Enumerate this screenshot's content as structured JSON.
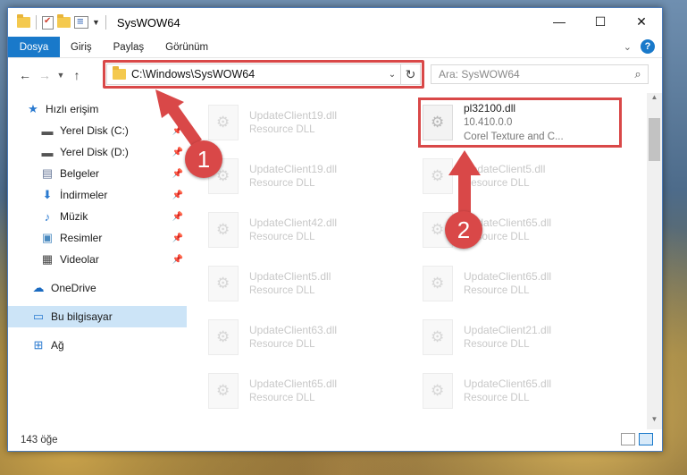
{
  "window": {
    "title": "SysWOW64"
  },
  "ribbon": {
    "tabs": [
      {
        "label": "Dosya"
      },
      {
        "label": "Giriş"
      },
      {
        "label": "Paylaş"
      },
      {
        "label": "Görünüm"
      }
    ],
    "help_label": "?"
  },
  "address": {
    "path": "C:\\Windows\\SysWOW64"
  },
  "search": {
    "placeholder": "Ara: SysWOW64"
  },
  "sidebar": {
    "items": [
      {
        "label": "Hızlı erişim",
        "icon": "star-icon"
      },
      {
        "label": "Yerel Disk (C:)",
        "icon": "drive-icon",
        "pinned": true
      },
      {
        "label": "Yerel Disk (D:)",
        "icon": "drive-icon",
        "pinned": true
      },
      {
        "label": "Belgeler",
        "icon": "documents-icon",
        "pinned": true
      },
      {
        "label": "İndirmeler",
        "icon": "download-icon",
        "pinned": true
      },
      {
        "label": "Müzik",
        "icon": "music-icon",
        "pinned": true
      },
      {
        "label": "Resimler",
        "icon": "pictures-icon",
        "pinned": true
      },
      {
        "label": "Videolar",
        "icon": "video-icon",
        "pinned": true
      },
      {
        "label": "OneDrive",
        "icon": "cloud-icon"
      },
      {
        "label": "Bu bilgisayar",
        "icon": "computer-icon",
        "selected": true
      },
      {
        "label": "Ağ",
        "icon": "network-icon"
      }
    ]
  },
  "files": {
    "highlighted": {
      "name": "pl32100.dll",
      "version": "10.410.0.0",
      "description": "Corel Texture and C..."
    },
    "left_column": [
      {
        "name": "UpdateClient19.dll",
        "type": "Resource DLL"
      },
      {
        "name": "UpdateClient19.dll",
        "type": "Resource DLL"
      },
      {
        "name": "UpdateClient42.dll",
        "type": "Resource DLL"
      },
      {
        "name": "UpdateClient5.dll",
        "type": "Resource DLL"
      },
      {
        "name": "UpdateClient63.dll",
        "type": "Resource DLL"
      },
      {
        "name": "UpdateClient65.dll",
        "type": "Resource DLL"
      }
    ],
    "right_column": [
      {
        "name": "UpdateClient5.dll",
        "type": "Resource DLL"
      },
      {
        "name": "UpdateClient65.dll",
        "type": "Resource DLL"
      },
      {
        "name": "UpdateClient65.dll",
        "type": "Resource DLL"
      },
      {
        "name": "UpdateClient21.dll",
        "type": "Resource DLL"
      },
      {
        "name": "UpdateClient65.dll",
        "type": "Resource DLL"
      }
    ]
  },
  "status": {
    "count": "143 öğe"
  },
  "annotations": {
    "step1": "1",
    "step2": "2",
    "color": "#d94848"
  }
}
